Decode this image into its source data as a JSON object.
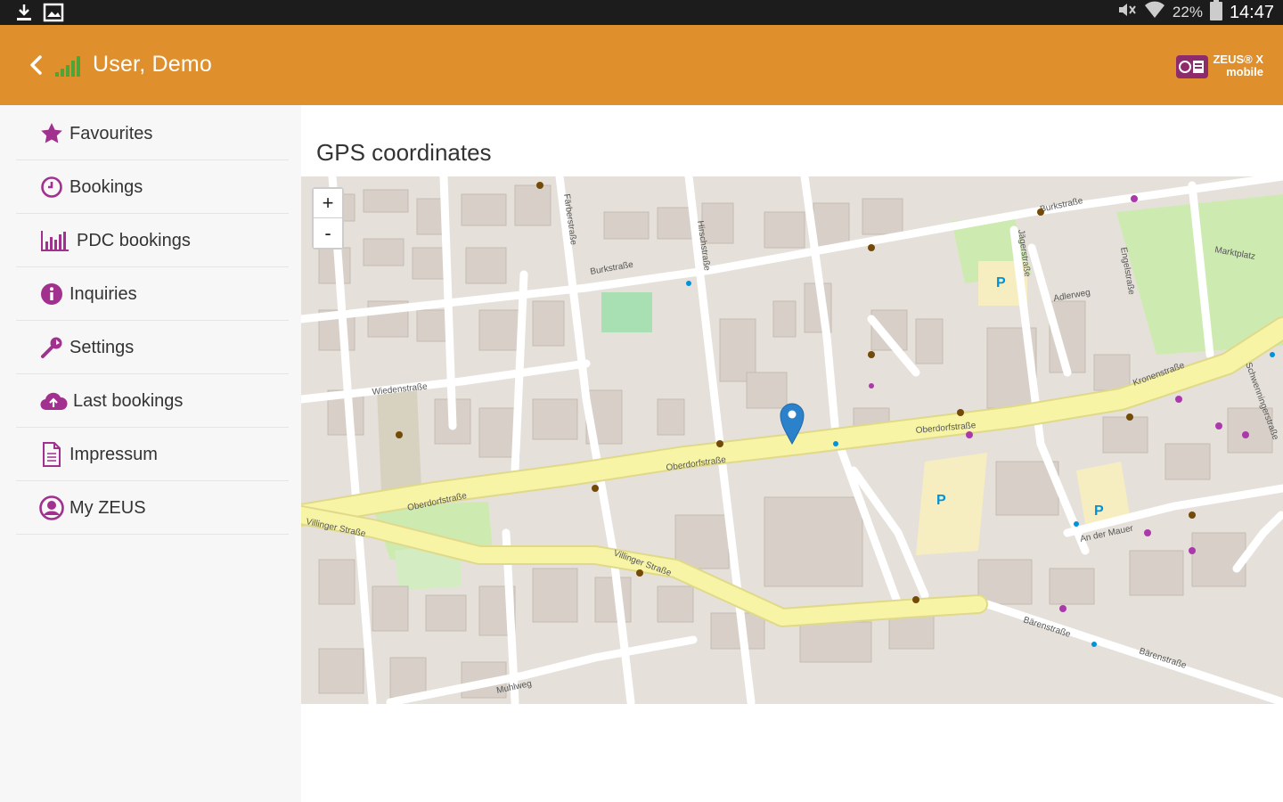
{
  "status_bar": {
    "battery": "22%",
    "time": "14:47",
    "left_icons": [
      "download-icon",
      "image-icon"
    ],
    "right_icons": [
      "mute-icon",
      "wifi-icon",
      "battery-icon"
    ]
  },
  "app_bar": {
    "title": "User, Demo",
    "color": "#df8f2b",
    "logo_line1": "ZEUS® X",
    "logo_line2": "mobile"
  },
  "sidebar": {
    "items": [
      {
        "label": "Favourites",
        "icon": "star-icon"
      },
      {
        "label": "Bookings",
        "icon": "clock-icon"
      },
      {
        "label": "PDC bookings",
        "icon": "bar-chart-icon"
      },
      {
        "label": "Inquiries",
        "icon": "info-icon"
      },
      {
        "label": "Settings",
        "icon": "wrench-icon"
      },
      {
        "label": "Last bookings",
        "icon": "cloud-upload-icon"
      },
      {
        "label": "Impressum",
        "icon": "document-icon"
      },
      {
        "label": "My ZEUS",
        "icon": "user-icon"
      }
    ],
    "accent_color": "#a1308f"
  },
  "main": {
    "heading": "GPS coordinates",
    "map": {
      "zoom_in_label": "+",
      "zoom_out_label": "-",
      "street_labels": [
        "Burkstraße",
        "Burkstraße",
        "Oberdorfstraße",
        "Oberdorfstraße",
        "Oberdorfstraße",
        "Wiedenstraße",
        "Villinger Straße",
        "Villinger Straße",
        "Kronenstraße",
        "Bärenstraße",
        "Bärenstraße",
        "Hirschstraße",
        "Jägerstraße",
        "Engelstraße",
        "Färberstraße",
        "Adlerweg",
        "Muhlweg",
        "An der Mauer",
        "Marktplatz",
        "Schwenningerstraße"
      ]
    }
  }
}
